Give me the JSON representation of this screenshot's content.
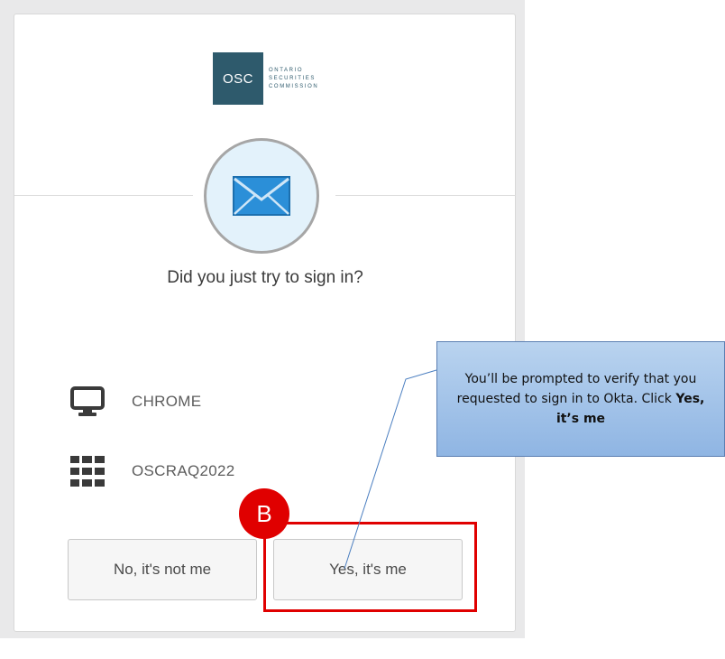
{
  "logo": {
    "box_text": "OSC",
    "lines": [
      "ONTARIO",
      "SECURITIES",
      "COMMISSION"
    ]
  },
  "icon": "email-envelope-icon",
  "title": "Did you just try to sign in?",
  "info": {
    "browser": {
      "icon": "monitor-icon",
      "label": "CHROME"
    },
    "device": {
      "icon": "grid-apps-icon",
      "label": "OSCRAQ2022"
    }
  },
  "buttons": {
    "no": "No, it's not me",
    "yes": "Yes, it's me"
  },
  "annotation": {
    "badge": "B",
    "callout_text": "You’ll be prompted to verify that you requested to sign in to Okta. Click ",
    "callout_bold": "Yes, it’s me"
  },
  "colors": {
    "brand": "#2e5a6c",
    "highlight": "#e00000",
    "callout_fill": "#a8c6ea",
    "icon_blue": "#2b8fd8"
  }
}
